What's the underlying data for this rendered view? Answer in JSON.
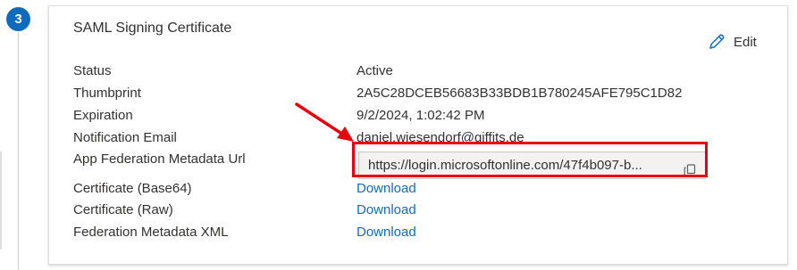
{
  "step": {
    "number": "3"
  },
  "card": {
    "title": "SAML Signing Certificate",
    "edit_label": "Edit",
    "rows": [
      {
        "label": "Status",
        "value": "Active"
      },
      {
        "label": "Thumbprint",
        "value": "2A5C28DCEB56683B33BDB1B780245AFE795C1D82"
      },
      {
        "label": "Expiration",
        "value": "9/2/2024, 1:02:42 PM"
      },
      {
        "label": "Notification Email",
        "value": "daniel.wiesendorf@giffits.de"
      },
      {
        "label": "App Federation Metadata Url",
        "value": "https://login.microsoftonline.com/47f4b097-b..."
      },
      {
        "label": "Certificate (Base64)",
        "value": "Download"
      },
      {
        "label": "Certificate (Raw)",
        "value": "Download"
      },
      {
        "label": "Federation Metadata XML",
        "value": "Download"
      }
    ]
  },
  "colors": {
    "accent": "#0f6cbd",
    "annotation": "#e8000b",
    "field_background": "#f3f2f1"
  },
  "icons": [
    "edit-icon",
    "copy-icon",
    "annotation-arrow"
  ]
}
